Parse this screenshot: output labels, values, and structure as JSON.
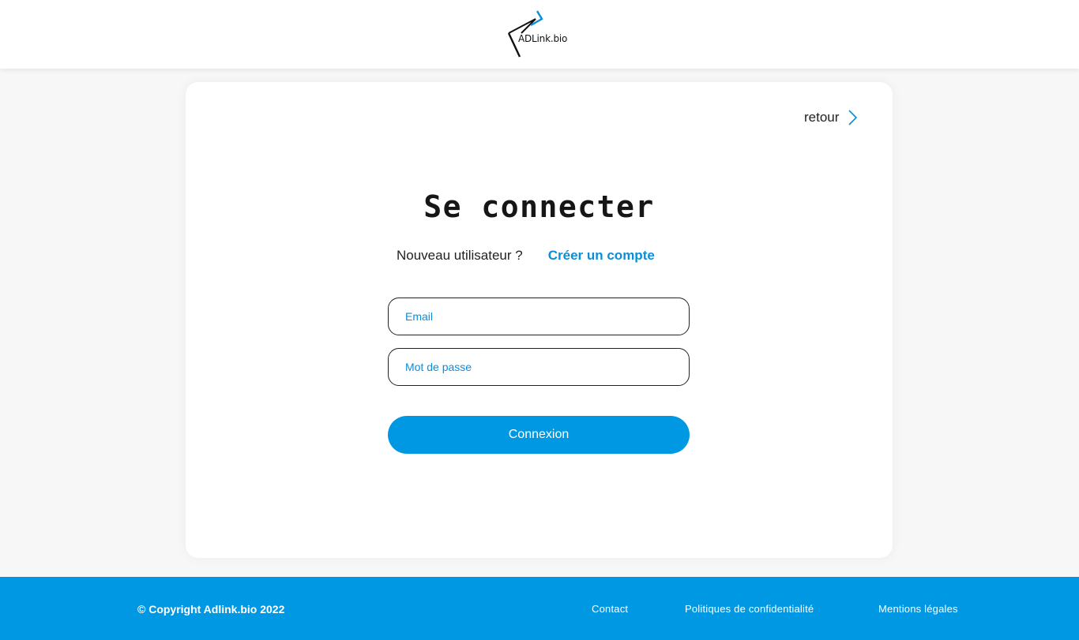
{
  "header": {
    "logo_text": "ADLink.bio"
  },
  "login": {
    "back_label": "retour",
    "title": "Se connecter",
    "new_user_question": "Nouveau utilisateur ?",
    "create_account_link": "Créer un compte",
    "email_placeholder": "Email",
    "password_placeholder": "Mot de passe",
    "submit_label": "Connexion"
  },
  "footer": {
    "copyright": "© Copyright Adlink.bio 2022",
    "links": [
      "Contact",
      "Politiques de confidentialité",
      "Mentions légales"
    ]
  },
  "colors": {
    "accent": "#0098e3",
    "link": "#0b8ed8",
    "background": "#f7f7f7"
  },
  "icons": {
    "back": "chevron-right-icon",
    "logo": "adlink-logo-mark-icon"
  }
}
